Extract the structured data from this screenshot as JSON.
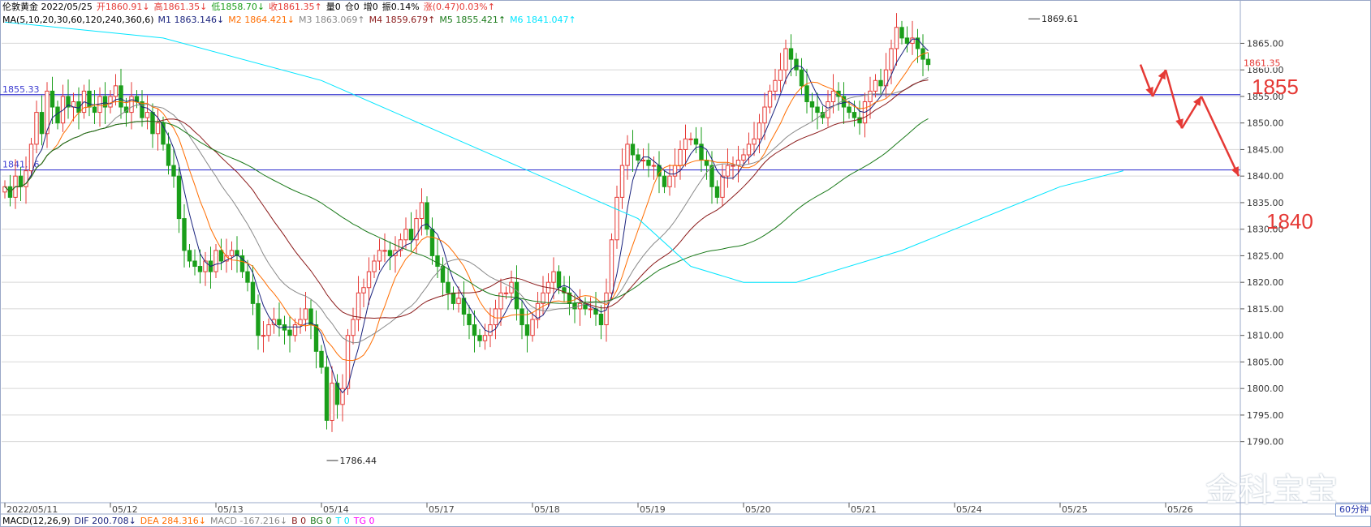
{
  "info": {
    "line1": [
      {
        "text": "伦敦黄金 2022/05/25",
        "color": "#000000"
      },
      {
        "text": "开1860.91↓",
        "color": "#e53935"
      },
      {
        "text": "高1861.35↓",
        "color": "#e53935"
      },
      {
        "text": "低1858.70↓",
        "color": "#1a9e1a"
      },
      {
        "text": "收1861.35↑",
        "color": "#e53935"
      },
      {
        "text": "量0",
        "color": "#000000"
      },
      {
        "text": "仓0",
        "color": "#000000"
      },
      {
        "text": "增0",
        "color": "#000000"
      },
      {
        "text": "振0.14%",
        "color": "#000000"
      },
      {
        "text": "涨(0.47)0.03%↑",
        "color": "#e53935"
      }
    ],
    "line2": [
      {
        "text": "MA(5,10,20,30,60,120,240,360,6)",
        "color": "#000000"
      },
      {
        "text": "M1 1863.146↓",
        "color": "#1a237e"
      },
      {
        "text": "M2 1864.421↓",
        "color": "#ff6d00"
      },
      {
        "text": "M3 1863.069↑",
        "color": "#888888"
      },
      {
        "text": "M4 1859.679↑",
        "color": "#8b1a1a"
      },
      {
        "text": "M5 1855.421↑",
        "color": "#1a7a1a"
      },
      {
        "text": "M6 1841.047↑",
        "color": "#00e5ff"
      }
    ]
  },
  "macd": [
    {
      "text": "MACD(12,26,9)",
      "color": "#000000"
    },
    {
      "text": "DIF 200.708↓",
      "color": "#1a237e"
    },
    {
      "text": "DEA 284.316↓",
      "color": "#ff6d00"
    },
    {
      "text": "MACD -167.216↓",
      "color": "#888888"
    },
    {
      "text": "B 0",
      "color": "#8b1a1a"
    },
    {
      "text": "BG 0",
      "color": "#1a7a1a"
    },
    {
      "text": "T 0",
      "color": "#00e5ff"
    },
    {
      "text": "TG 0",
      "color": "#ff00ff"
    }
  ],
  "annotations": {
    "level_upper": "1855",
    "level_lower": "1840",
    "line_label_upper": "1855.33",
    "line_label_lower": "1841.16",
    "high_label": "1869.61",
    "low_label": "1786.44",
    "last_price": "1861.35"
  },
  "watermark": "金科宝宝",
  "timeframe": "60分钟",
  "colors": {
    "up": "#e53935",
    "down": "#1a9e1a",
    "hline": "#3a3ad0",
    "arrow": "#e53935",
    "grid": "#d8d8d8"
  },
  "chart_data": {
    "type": "candlestick",
    "symbol": "伦敦黄金",
    "timeframe": "60分钟",
    "ylim": [
      1785,
      1870
    ],
    "yticks": [
      1790,
      1795,
      1800,
      1805,
      1810,
      1815,
      1820,
      1825,
      1830,
      1835,
      1840,
      1845,
      1850,
      1855,
      1860,
      1865
    ],
    "xticks": [
      {
        "label": "2022/05/11",
        "index": 0
      },
      {
        "label": "05/12",
        "index": 20
      },
      {
        "label": "05/13",
        "index": 40
      },
      {
        "label": "05/14",
        "index": 60
      },
      {
        "label": "05/17",
        "index": 80
      },
      {
        "label": "05/18",
        "index": 100
      },
      {
        "label": "05/19",
        "index": 120
      },
      {
        "label": "05/20",
        "index": 140
      },
      {
        "label": "05/21",
        "index": 160
      },
      {
        "label": "05/24",
        "index": 180
      },
      {
        "label": "05/25",
        "index": 200
      },
      {
        "label": "05/26",
        "index": 220
      }
    ],
    "horizontal_lines": [
      1855.33,
      1841.16
    ],
    "close": [
      1838,
      1836,
      1840,
      1838,
      1841,
      1846,
      1852,
      1848,
      1856,
      1853,
      1850,
      1855,
      1853,
      1854,
      1852,
      1856,
      1853,
      1852,
      1855,
      1853,
      1855,
      1857,
      1853,
      1852,
      1855,
      1854,
      1851,
      1852,
      1848,
      1850,
      1846,
      1842,
      1840,
      1832,
      1826,
      1824,
      1823,
      1822,
      1824,
      1822,
      1826,
      1824,
      1825,
      1826,
      1825,
      1822,
      1820,
      1816,
      1810,
      1810,
      1812,
      1813,
      1812,
      1811,
      1810,
      1812,
      1813,
      1815,
      1812,
      1807,
      1804,
      1794,
      1801,
      1797,
      1800,
      1810,
      1813,
      1818,
      1819,
      1822,
      1824,
      1826,
      1826,
      1825,
      1826,
      1828,
      1830,
      1828,
      1832,
      1835,
      1830,
      1825,
      1823,
      1820,
      1818,
      1816,
      1817,
      1814,
      1812,
      1810,
      1809,
      1810,
      1812,
      1815,
      1818,
      1818,
      1820,
      1815,
      1812,
      1810,
      1813,
      1816,
      1818,
      1820,
      1822,
      1819,
      1818,
      1816,
      1815,
      1816,
      1815,
      1815,
      1814,
      1812,
      1818,
      1828,
      1836,
      1842,
      1846,
      1844,
      1843,
      1843,
      1842,
      1842,
      1840,
      1838,
      1840,
      1842,
      1845,
      1847,
      1847,
      1846,
      1843,
      1842,
      1838,
      1836,
      1840,
      1842,
      1842,
      1843,
      1844,
      1846,
      1847,
      1850,
      1853,
      1856,
      1858,
      1860,
      1864,
      1862,
      1860,
      1857,
      1854,
      1853,
      1852,
      1851,
      1854,
      1856,
      1855,
      1853,
      1852,
      1851,
      1850,
      1854,
      1856,
      1858,
      1857,
      1860,
      1864,
      1868,
      1866,
      1865,
      1866,
      1864,
      1862,
      1861
    ],
    "high_mark": {
      "value": 1869.61,
      "label": "1869.61"
    },
    "low_mark": {
      "value": 1786.44,
      "label": "1786.44"
    },
    "moving_averages": [
      {
        "name": "M1",
        "period": 5,
        "last": 1863.146
      },
      {
        "name": "M2",
        "period": 10,
        "last": 1864.421
      },
      {
        "name": "M3",
        "period": 20,
        "last": 1863.069
      },
      {
        "name": "M4",
        "period": 30,
        "last": 1859.679
      },
      {
        "name": "M5",
        "period": 60,
        "last": 1855.421
      },
      {
        "name": "M6",
        "period": 120,
        "last": 1841.047
      }
    ],
    "forecast_path": [
      1861,
      1855,
      1860,
      1849,
      1855,
      1840
    ],
    "ylabel": "",
    "xlabel": ""
  }
}
